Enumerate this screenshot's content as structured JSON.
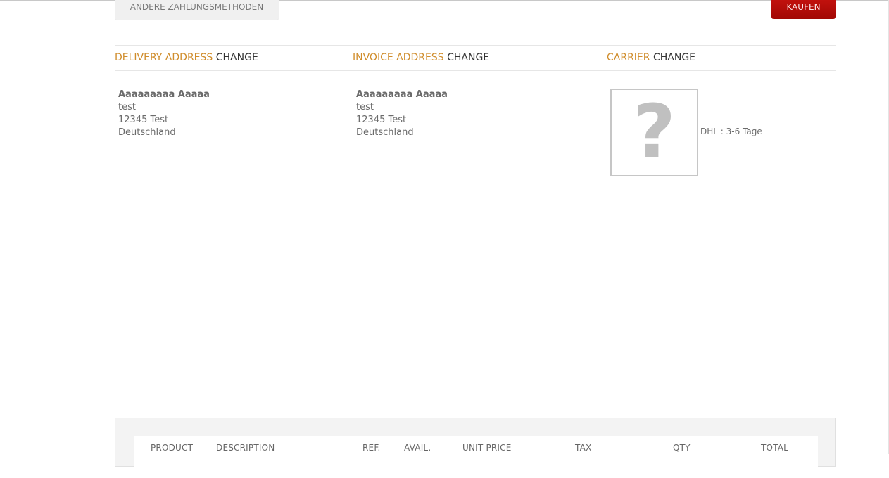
{
  "buttons": {
    "other_payment": "ANDERE ZAHLUNGSMETHODEN",
    "buy": "KAUFEN"
  },
  "sections": {
    "delivery": {
      "title": "DELIVERY ADDRESS",
      "change": "CHANGE"
    },
    "invoice": {
      "title": "INVOICE ADDRESS",
      "change": "CHANGE"
    },
    "carrier": {
      "title": "CARRIER",
      "change": "CHANGE"
    }
  },
  "delivery_address": {
    "name": "Aaaaaaaaa Aaaaa",
    "line1": "test",
    "line2": "12345 Test",
    "country": "Deutschland"
  },
  "invoice_address": {
    "name": "Aaaaaaaaa Aaaaa",
    "line1": "test",
    "line2": "12345 Test",
    "country": "Deutschland"
  },
  "carrier": {
    "image_placeholder": "?",
    "label": "DHL : 3-6 Tage"
  },
  "cart_table": {
    "headers": {
      "product": "PRODUCT",
      "description": "DESCRIPTION",
      "ref": "REF.",
      "avail": "AVAIL.",
      "unit_price": "UNIT PRICE",
      "tax": "TAX",
      "qty": "QTY",
      "total": "TOTAL"
    }
  },
  "colors": {
    "accent": "#d08d2c",
    "buy_button": "#b20e09",
    "text": "#666666"
  }
}
